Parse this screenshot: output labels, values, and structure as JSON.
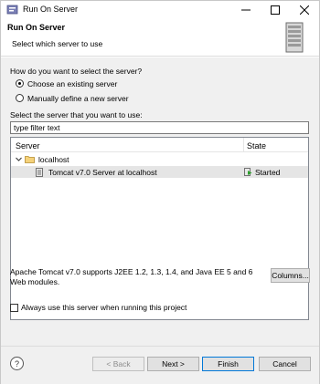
{
  "window": {
    "title": "Run On Server",
    "controls": {
      "minimize": "minimize-icon",
      "maximize": "maximize-icon",
      "close": "close-icon"
    }
  },
  "banner": {
    "title": "Run On Server",
    "subtitle": "Select which server to use",
    "image": "server-wizard-icon"
  },
  "selection": {
    "question": "How do you want to select the server?",
    "option_existing": "Choose an existing server",
    "option_manual": "Manually define a new server",
    "selected": "existing"
  },
  "filter": {
    "label": "Select the server that you want to use:",
    "value": "type filter text"
  },
  "tree": {
    "columns": [
      "Server",
      "State"
    ],
    "nodes": [
      {
        "label": "localhost",
        "icon": "folder-icon",
        "expanded": true
      },
      {
        "label": "Tomcat v7.0 Server at localhost",
        "icon": "server-icon",
        "state": "Started",
        "state_icon": "started-icon",
        "selected": true
      }
    ]
  },
  "description": "Apache Tomcat v7.0 supports J2EE 1.2, 1.3, 1.4, and Java EE 5 and 6 Web modules.",
  "columns_button": "Columns...",
  "always_use_checkbox": {
    "label": "Always use this server when running this project",
    "checked": false
  },
  "footer": {
    "back": "< Back",
    "next": "Next >",
    "finish": "Finish",
    "cancel": "Cancel",
    "help": "?"
  },
  "colors": {
    "accent": "#0078d7",
    "selection": "#e5e5e5",
    "panel": "#f0f0f0"
  }
}
